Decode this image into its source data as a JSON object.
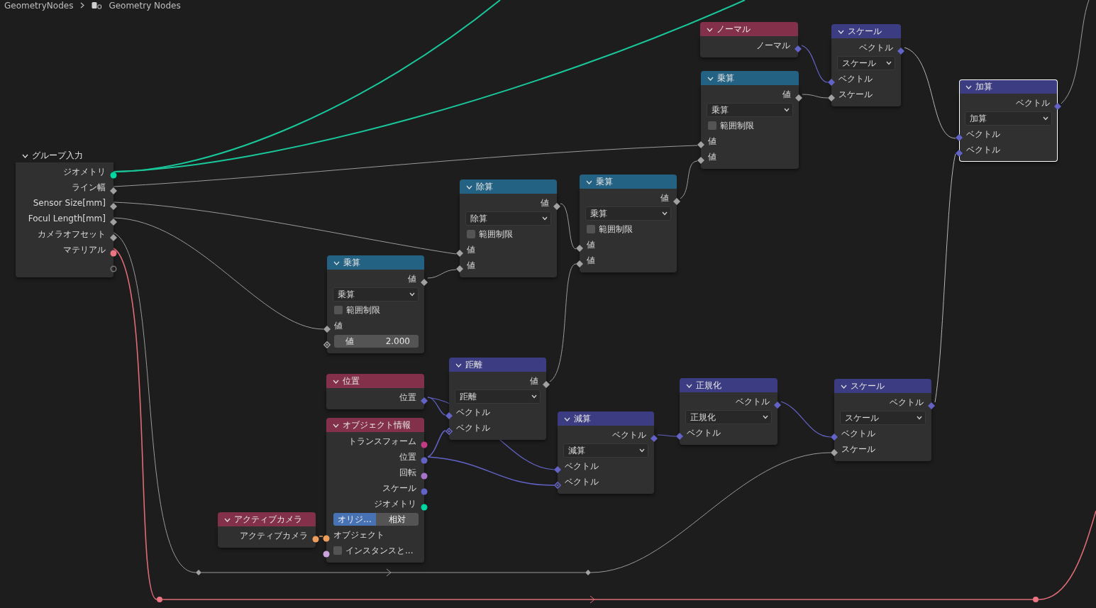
{
  "breadcrumb": [
    {
      "label": "GeometryNodes"
    },
    {
      "label": "Geometry Nodes"
    }
  ],
  "nodes": [
    {
      "title": "グループ入力",
      "color": "#1d1d1d",
      "selected": false,
      "rows": [
        {
          "kind": "output",
          "label": "ジオメトリ",
          "socket": {
            "kind": "circle",
            "color": "#00d6a3"
          }
        },
        {
          "kind": "output",
          "label": "ライン幅",
          "socket": {
            "kind": "diamond",
            "color": "#a1a1a1"
          }
        },
        {
          "kind": "output",
          "label": "Sensor Size[mm]",
          "socket": {
            "kind": "diamond",
            "color": "#a1a1a1"
          }
        },
        {
          "kind": "output",
          "label": "Focul Length[mm]",
          "socket": {
            "kind": "diamond",
            "color": "#a1a1a1"
          }
        },
        {
          "kind": "output",
          "label": "カメラオフセット",
          "socket": {
            "kind": "diamond",
            "color": "#a1a1a1"
          }
        },
        {
          "kind": "output",
          "label": "マテリアル",
          "socket": {
            "kind": "circle",
            "color": "#eb7582"
          }
        },
        {
          "kind": "empty",
          "socket": {
            "kind": "hollow",
            "color": "#777777"
          }
        }
      ]
    },
    {
      "title": "ノーマル",
      "color": "#83314a",
      "selected": false,
      "rows": [
        {
          "kind": "output",
          "label": "ノーマル",
          "socket": {
            "kind": "diamond",
            "color": "#6363c7"
          }
        }
      ]
    },
    {
      "title": "スケール",
      "color": "#3c3c83",
      "selected": false,
      "rows": [
        {
          "kind": "output",
          "label": "ベクトル",
          "socket": {
            "kind": "diamond",
            "color": "#6363c7"
          }
        },
        {
          "kind": "dropdown",
          "value": "スケール"
        },
        {
          "kind": "input",
          "label": "ベクトル",
          "socket": {
            "kind": "diamond",
            "color": "#6363c7"
          }
        },
        {
          "kind": "input",
          "label": "スケール",
          "socket": {
            "kind": "diamond",
            "color": "#a1a1a1"
          }
        }
      ]
    },
    {
      "title": "乗算",
      "color": "#246283",
      "selected": false,
      "rows": [
        {
          "kind": "output",
          "label": "値",
          "socket": {
            "kind": "diamond",
            "color": "#a1a1a1"
          }
        },
        {
          "kind": "dropdown",
          "value": "乗算"
        },
        {
          "kind": "checkbox",
          "label": "範囲制限",
          "checked": false
        },
        {
          "kind": "input",
          "label": "値",
          "socket": {
            "kind": "diamond",
            "color": "#a1a1a1"
          }
        },
        {
          "kind": "input",
          "label": "値",
          "socket": {
            "kind": "diamond",
            "color": "#a1a1a1"
          }
        }
      ]
    },
    {
      "title": "加算",
      "color": "#3c3c83",
      "selected": true,
      "rows": [
        {
          "kind": "output",
          "label": "ベクトル",
          "socket": {
            "kind": "diamond",
            "color": "#6363c7"
          }
        },
        {
          "kind": "dropdown",
          "value": "加算"
        },
        {
          "kind": "input",
          "label": "ベクトル",
          "socket": {
            "kind": "diamond",
            "color": "#6363c7"
          }
        },
        {
          "kind": "input",
          "label": "ベクトル",
          "socket": {
            "kind": "diamond",
            "color": "#6363c7"
          }
        }
      ]
    },
    {
      "title": "除算",
      "color": "#246283",
      "selected": false,
      "rows": [
        {
          "kind": "output",
          "label": "値",
          "socket": {
            "kind": "diamond",
            "color": "#a1a1a1"
          }
        },
        {
          "kind": "dropdown",
          "value": "除算"
        },
        {
          "kind": "checkbox",
          "label": "範囲制限",
          "checked": false
        },
        {
          "kind": "input",
          "label": "値",
          "socket": {
            "kind": "diamond",
            "color": "#a1a1a1"
          }
        },
        {
          "kind": "input",
          "label": "値",
          "socket": {
            "kind": "diamond",
            "color": "#a1a1a1"
          }
        }
      ]
    },
    {
      "title": "乗算",
      "color": "#246283",
      "selected": false,
      "rows": [
        {
          "kind": "output",
          "label": "値",
          "socket": {
            "kind": "diamond",
            "color": "#a1a1a1"
          }
        },
        {
          "kind": "dropdown",
          "value": "乗算"
        },
        {
          "kind": "checkbox",
          "label": "範囲制限",
          "checked": false
        },
        {
          "kind": "input",
          "label": "値",
          "socket": {
            "kind": "diamond",
            "color": "#a1a1a1"
          }
        },
        {
          "kind": "input",
          "label": "値",
          "socket": {
            "kind": "diamond",
            "color": "#a1a1a1"
          }
        }
      ]
    },
    {
      "title": "乗算",
      "color": "#246283",
      "selected": false,
      "rows": [
        {
          "kind": "output",
          "label": "値",
          "socket": {
            "kind": "diamond",
            "color": "#a1a1a1"
          }
        },
        {
          "kind": "dropdown",
          "value": "乗算"
        },
        {
          "kind": "checkbox",
          "label": "範囲制限",
          "checked": false
        },
        {
          "kind": "input",
          "label": "値",
          "socket": {
            "kind": "diamond",
            "color": "#a1a1a1"
          }
        },
        {
          "kind": "field",
          "label": "値",
          "value": "2.000",
          "socket": {
            "kind": "diamond-dot",
            "color": "#a1a1a1"
          }
        }
      ]
    },
    {
      "title": "位置",
      "color": "#83314a",
      "selected": false,
      "rows": [
        {
          "kind": "output",
          "label": "位置",
          "socket": {
            "kind": "diamond",
            "color": "#6363c7"
          }
        }
      ]
    },
    {
      "title": "距離",
      "color": "#3c3c83",
      "selected": false,
      "rows": [
        {
          "kind": "output",
          "label": "値",
          "socket": {
            "kind": "diamond",
            "color": "#a1a1a1"
          }
        },
        {
          "kind": "dropdown",
          "value": "距離"
        },
        {
          "kind": "input",
          "label": "ベクトル",
          "socket": {
            "kind": "diamond",
            "color": "#6363c7"
          }
        },
        {
          "kind": "input",
          "label": "ベクトル",
          "socket": {
            "kind": "diamond-dot",
            "color": "#6363c7"
          }
        }
      ]
    },
    {
      "title": "オブジェクト情報",
      "color": "#83314a",
      "selected": false,
      "rows": [
        {
          "kind": "output",
          "label": "トランスフォーム",
          "socket": {
            "kind": "circle",
            "color": "#c33a85"
          }
        },
        {
          "kind": "output",
          "label": "位置",
          "socket": {
            "kind": "circle",
            "color": "#6363c7"
          }
        },
        {
          "kind": "output",
          "label": "回転",
          "socket": {
            "kind": "circle",
            "color": "#a574c9"
          }
        },
        {
          "kind": "output",
          "label": "スケール",
          "socket": {
            "kind": "circle",
            "color": "#6363c7"
          }
        },
        {
          "kind": "output",
          "label": "ジオメトリ",
          "socket": {
            "kind": "circle",
            "color": "#00d6a3"
          }
        },
        {
          "kind": "toggle",
          "options": [
            {
              "label": "オリジ...",
              "selected": true
            },
            {
              "label": "相対",
              "selected": false
            }
          ]
        },
        {
          "kind": "input",
          "label": "オブジェクト",
          "socket": {
            "kind": "circle",
            "color": "#ed9e5c"
          }
        },
        {
          "kind": "input-checkbox",
          "label": "インスタンスと...",
          "checked": false,
          "socket": {
            "kind": "circle",
            "color": "#c9a2de"
          }
        }
      ]
    },
    {
      "title": "アクティブカメラ",
      "color": "#83314a",
      "selected": false,
      "rows": [
        {
          "kind": "output",
          "label": "アクティブカメラ",
          "socket": {
            "kind": "circle",
            "color": "#ed9e5c"
          }
        }
      ]
    },
    {
      "title": "減算",
      "color": "#3c3c83",
      "selected": false,
      "rows": [
        {
          "kind": "output",
          "label": "ベクトル",
          "socket": {
            "kind": "diamond",
            "color": "#6363c7"
          }
        },
        {
          "kind": "dropdown",
          "value": "減算"
        },
        {
          "kind": "input",
          "label": "ベクトル",
          "socket": {
            "kind": "diamond",
            "color": "#6363c7"
          }
        },
        {
          "kind": "input",
          "label": "ベクトル",
          "socket": {
            "kind": "diamond-dot",
            "color": "#6363c7"
          }
        }
      ]
    },
    {
      "title": "正規化",
      "color": "#3c3c83",
      "selected": false,
      "rows": [
        {
          "kind": "output",
          "label": "ベクトル",
          "socket": {
            "kind": "diamond",
            "color": "#6363c7"
          }
        },
        {
          "kind": "dropdown",
          "value": "正規化"
        },
        {
          "kind": "input",
          "label": "ベクトル",
          "socket": {
            "kind": "diamond",
            "color": "#6363c7"
          }
        }
      ]
    },
    {
      "title": "スケール",
      "color": "#3c3c83",
      "selected": false,
      "rows": [
        {
          "kind": "output",
          "label": "ベクトル",
          "socket": {
            "kind": "diamond",
            "color": "#6363c7"
          }
        },
        {
          "kind": "dropdown",
          "value": "スケール"
        },
        {
          "kind": "input",
          "label": "ベクトル",
          "socket": {
            "kind": "diamond",
            "color": "#6363c7"
          }
        },
        {
          "kind": "input",
          "label": "スケール",
          "socket": {
            "kind": "diamond",
            "color": "#a1a1a1"
          }
        }
      ]
    }
  ]
}
